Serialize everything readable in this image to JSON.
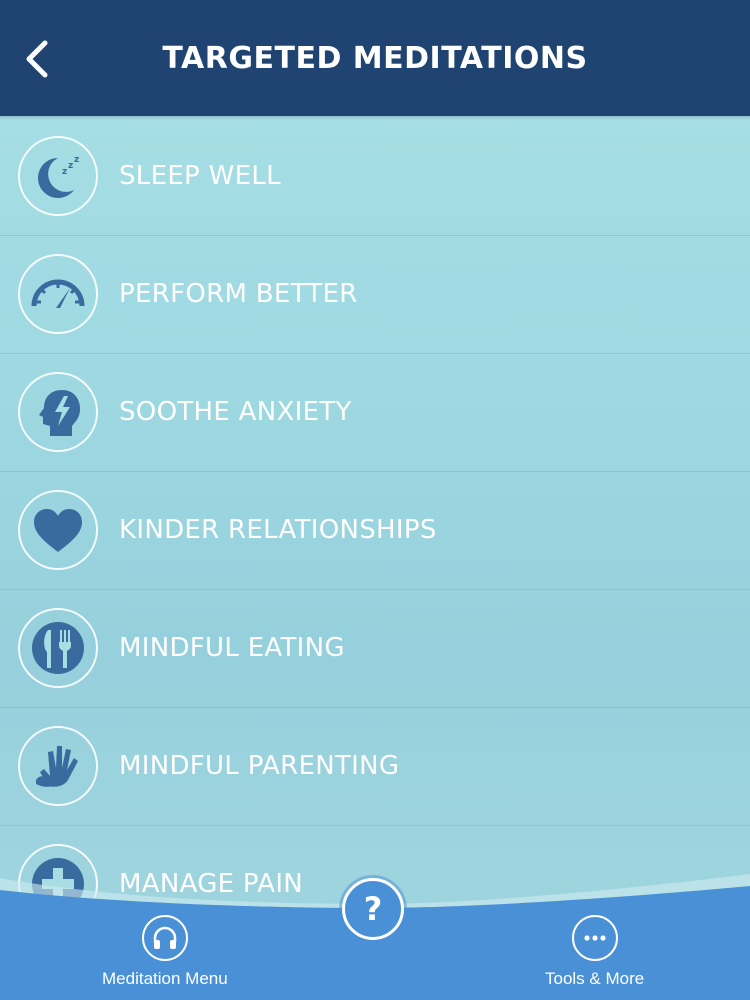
{
  "header": {
    "title": "TARGETED MEDITATIONS",
    "back_icon": "chevron-left-icon"
  },
  "meditations": [
    {
      "label": "SLEEP WELL",
      "icon": "moon-sleep-icon"
    },
    {
      "label": "PERFORM BETTER",
      "icon": "speedometer-icon"
    },
    {
      "label": "SOOTHE ANXIETY",
      "icon": "head-lightning-icon"
    },
    {
      "label": "KINDER RELATIONSHIPS",
      "icon": "heart-icon"
    },
    {
      "label": "MINDFUL EATING",
      "icon": "knife-fork-icon"
    },
    {
      "label": "MINDFUL PARENTING",
      "icon": "hands-icon"
    },
    {
      "label": "MANAGE PAIN",
      "icon": "plus-cross-icon"
    }
  ],
  "tabbar": {
    "left": {
      "label": "Meditation Menu",
      "icon": "headphones-icon"
    },
    "center": {
      "label": "?",
      "icon": "help-icon"
    },
    "right": {
      "label": "Tools & More",
      "icon": "more-dots-icon"
    }
  },
  "colors": {
    "header_bg": "#1f4472",
    "icon_fill": "#3a6b9e",
    "tabbar_bg": "#4a90d6",
    "background": "#a0d9e0"
  }
}
